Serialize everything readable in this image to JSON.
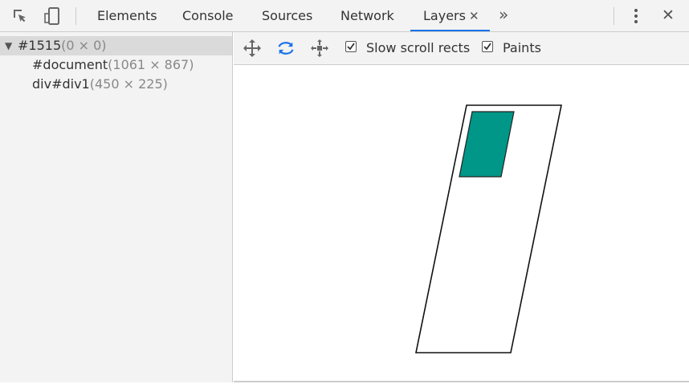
{
  "toolbar": {
    "inspect_icon": "inspect-element-icon",
    "device_icon": "device-toggle-icon",
    "tabs": [
      {
        "label": "Elements"
      },
      {
        "label": "Console"
      },
      {
        "label": "Sources"
      },
      {
        "label": "Network"
      },
      {
        "label": "Layers",
        "active": true
      }
    ],
    "close_tab_glyph": "✕",
    "more_tabs_glyph": "»",
    "menu_icon": "kebab-menu-icon",
    "close_glyph": "✕"
  },
  "layer_tree": {
    "expand_glyph": "▼",
    "items": [
      {
        "name": "#1515",
        "size": "(0 × 0)",
        "selected": true
      },
      {
        "name": "#document",
        "size": "(1061 × 867)"
      },
      {
        "name": "div#div1",
        "size": "(450 × 225)"
      }
    ]
  },
  "layers_toolbar": {
    "pan_icon": "pan-mode-icon",
    "rotate_icon": "rotate-mode-icon",
    "reset_icon": "reset-transform-icon",
    "slow_scroll_label": "Slow scroll rects",
    "slow_scroll_checked": true,
    "paints_label": "Paints",
    "paints_checked": true
  },
  "viewport": {
    "layer_fill_color": "#009688"
  },
  "colors": {
    "accent": "#1a73e8",
    "panel_bg": "#f3f3f3",
    "selected_row": "#dadada"
  }
}
